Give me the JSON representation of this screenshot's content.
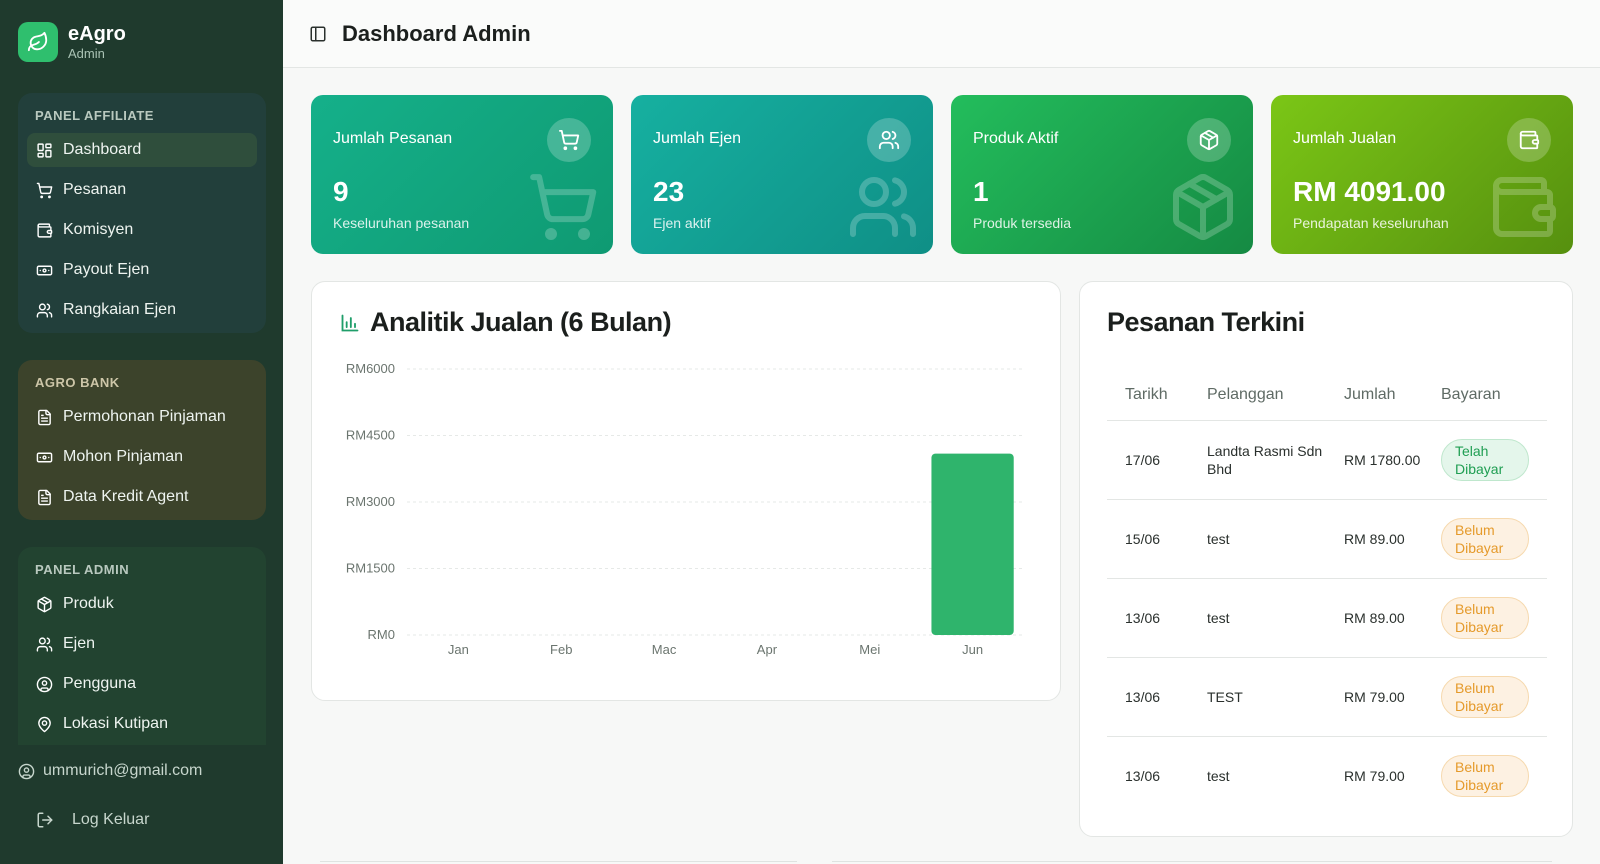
{
  "brand": {
    "name": "eAgro",
    "subtitle": "Admin"
  },
  "sidebar": {
    "affiliate": {
      "title": "PANEL AFFILIATE",
      "items": [
        {
          "label": "Dashboard",
          "icon": "dashboard-icon",
          "active": true
        },
        {
          "label": "Pesanan",
          "icon": "cart-icon"
        },
        {
          "label": "Komisyen",
          "icon": "wallet-icon"
        },
        {
          "label": "Payout Ejen",
          "icon": "banknote-icon"
        },
        {
          "label": "Rangkaian Ejen",
          "icon": "users-icon"
        }
      ]
    },
    "bank": {
      "title": "AGRO BANK",
      "items": [
        {
          "label": "Permohonan Pinjaman",
          "icon": "document-icon"
        },
        {
          "label": "Mohon Pinjaman",
          "icon": "banknote-icon"
        },
        {
          "label": "Data Kredit Agent",
          "icon": "document-icon"
        }
      ]
    },
    "admin": {
      "title": "PANEL ADMIN",
      "items": [
        {
          "label": "Produk",
          "icon": "package-icon"
        },
        {
          "label": "Ejen",
          "icon": "users-icon"
        },
        {
          "label": "Pengguna",
          "icon": "user-circle-icon"
        },
        {
          "label": "Lokasi Kutipan",
          "icon": "map-pin-icon"
        }
      ]
    },
    "user_email": "ummurich@gmail.com",
    "logout_label": "Log Keluar"
  },
  "header": {
    "title": "Dashboard Admin"
  },
  "stats": [
    {
      "label": "Jumlah Pesanan",
      "value": "9",
      "sub": "Keseluruhan pesanan",
      "icon": "cart-icon",
      "color": "#12a67f"
    },
    {
      "label": "Jumlah Ejen",
      "value": "23",
      "sub": "Ejen aktif",
      "icon": "users-icon",
      "color": "#13a394"
    },
    {
      "label": "Produk Aktif",
      "value": "1",
      "sub": "Produk tersedia",
      "icon": "package-icon",
      "color": "#1fa650"
    },
    {
      "label": "Jumlah Jualan",
      "value": "RM 4091.00",
      "sub": "Pendapatan keseluruhan",
      "icon": "wallet-icon",
      "color": "#6aad13"
    }
  ],
  "chart_panel": {
    "title": "Analitik Jualan (6 Bulan)"
  },
  "chart_data": {
    "type": "bar",
    "categories": [
      "Jan",
      "Feb",
      "Mac",
      "Apr",
      "Mei",
      "Jun"
    ],
    "values": [
      0,
      0,
      0,
      0,
      0,
      4091
    ],
    "ylim": [
      0,
      6000
    ],
    "yticks": [
      0,
      1500,
      3000,
      4500,
      6000
    ],
    "ytick_labels": [
      "RM0",
      "RM1500",
      "RM3000",
      "RM4500",
      "RM6000"
    ],
    "grid": true,
    "bar_color": "#2fb46c"
  },
  "orders": {
    "title": "Pesanan Terkini",
    "columns": [
      "Tarikh",
      "Pelanggan",
      "Jumlah",
      "Bayaran"
    ],
    "rows": [
      {
        "date": "17/06",
        "customer": "Landta Rasmi Sdn Bhd",
        "amount": "RM 1780.00",
        "status": "Telah Dibayar",
        "paid": true
      },
      {
        "date": "15/06",
        "customer": "test",
        "amount": "RM 89.00",
        "status": "Belum Dibayar",
        "paid": false
      },
      {
        "date": "13/06",
        "customer": "test",
        "amount": "RM 89.00",
        "status": "Belum Dibayar",
        "paid": false
      },
      {
        "date": "13/06",
        "customer": "TEST",
        "amount": "RM 79.00",
        "status": "Belum Dibayar",
        "paid": false
      },
      {
        "date": "13/06",
        "customer": "test",
        "amount": "RM 79.00",
        "status": "Belum Dibayar",
        "paid": false
      }
    ]
  }
}
